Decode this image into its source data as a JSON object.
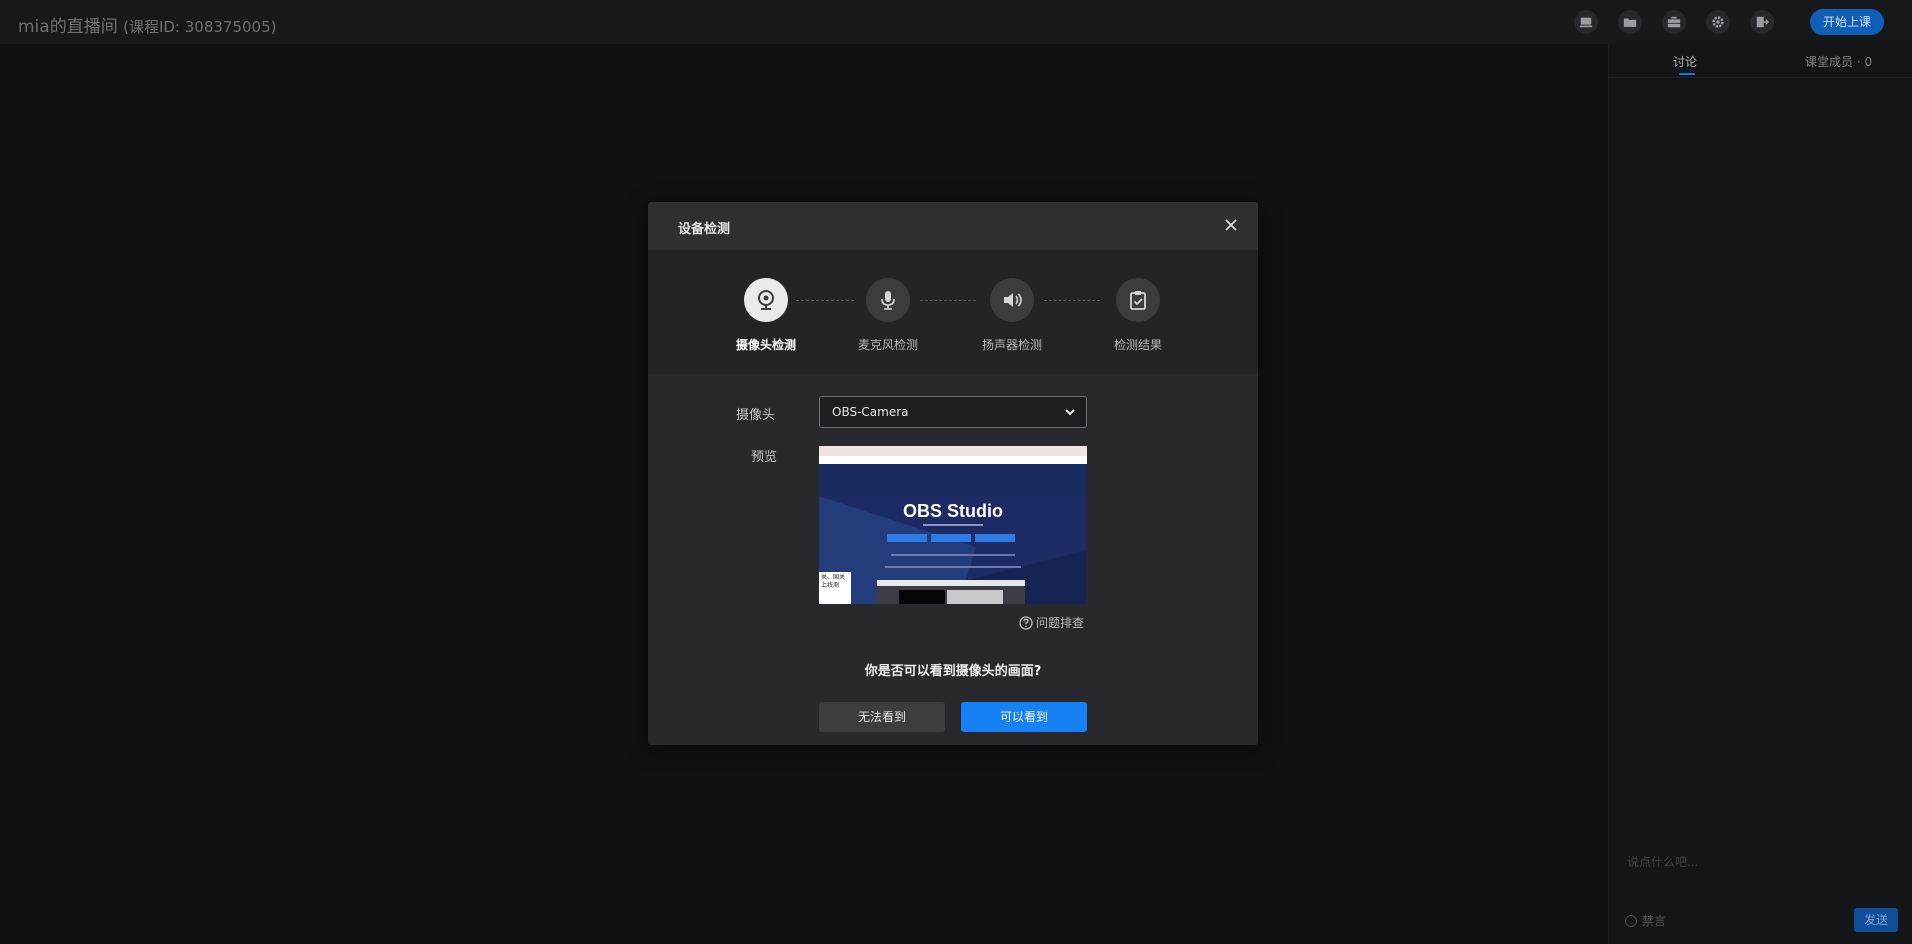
{
  "header": {
    "room_name": "mia的直播间",
    "course_id": "(课程ID: 308375005)",
    "start_class": "开始上课",
    "icons": [
      "monitor-icon",
      "folder-icon",
      "toolbox-icon",
      "gear-icon",
      "exit-icon"
    ]
  },
  "right_panel": {
    "tabs": [
      {
        "label": "讨论"
      },
      {
        "label": "课堂成员 · 0"
      }
    ],
    "chat_placeholder": "说点什么吧...",
    "mute_label": "禁言",
    "send_label": "发送"
  },
  "modal": {
    "title": "设备检测",
    "steps": [
      {
        "label": "摄像头检测",
        "icon": "camera-icon",
        "active": true
      },
      {
        "label": "麦克风检测",
        "icon": "microphone-icon",
        "active": false
      },
      {
        "label": "扬声器检测",
        "icon": "speaker-icon",
        "active": false
      },
      {
        "label": "检测结果",
        "icon": "clipboard-check-icon",
        "active": false
      }
    ],
    "camera_label": "摄像头",
    "camera_value": "OBS-Camera",
    "preview_label": "预览",
    "preview_title": "OBS Studio",
    "preview_note": "关、国关上线测",
    "troubleshoot": "问题排查",
    "question": "你是否可以看到摄像头的画面?",
    "cannot_see": "无法看到",
    "can_see": "可以看到"
  },
  "colors": {
    "accent": "#1680f5",
    "background": "#101113",
    "modal": "#28292c"
  }
}
